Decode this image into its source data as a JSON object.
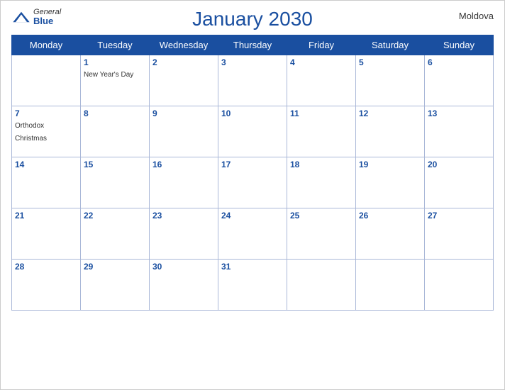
{
  "header": {
    "title": "January 2030",
    "country": "Moldova",
    "logo": {
      "general": "General",
      "blue": "Blue"
    }
  },
  "weekdays": [
    "Monday",
    "Tuesday",
    "Wednesday",
    "Thursday",
    "Friday",
    "Saturday",
    "Sunday"
  ],
  "weeks": [
    [
      {
        "day": "",
        "empty": true
      },
      {
        "day": "1",
        "event": "New Year's Day"
      },
      {
        "day": "2",
        "event": ""
      },
      {
        "day": "3",
        "event": ""
      },
      {
        "day": "4",
        "event": ""
      },
      {
        "day": "5",
        "event": ""
      },
      {
        "day": "6",
        "event": ""
      }
    ],
    [
      {
        "day": "7",
        "event": "Orthodox Christmas"
      },
      {
        "day": "8",
        "event": ""
      },
      {
        "day": "9",
        "event": ""
      },
      {
        "day": "10",
        "event": ""
      },
      {
        "day": "11",
        "event": ""
      },
      {
        "day": "12",
        "event": ""
      },
      {
        "day": "13",
        "event": ""
      }
    ],
    [
      {
        "day": "14",
        "event": ""
      },
      {
        "day": "15",
        "event": ""
      },
      {
        "day": "16",
        "event": ""
      },
      {
        "day": "17",
        "event": ""
      },
      {
        "day": "18",
        "event": ""
      },
      {
        "day": "19",
        "event": ""
      },
      {
        "day": "20",
        "event": ""
      }
    ],
    [
      {
        "day": "21",
        "event": ""
      },
      {
        "day": "22",
        "event": ""
      },
      {
        "day": "23",
        "event": ""
      },
      {
        "day": "24",
        "event": ""
      },
      {
        "day": "25",
        "event": ""
      },
      {
        "day": "26",
        "event": ""
      },
      {
        "day": "27",
        "event": ""
      }
    ],
    [
      {
        "day": "28",
        "event": ""
      },
      {
        "day": "29",
        "event": ""
      },
      {
        "day": "30",
        "event": ""
      },
      {
        "day": "31",
        "event": ""
      },
      {
        "day": "",
        "empty": true
      },
      {
        "day": "",
        "empty": true
      },
      {
        "day": "",
        "empty": true
      }
    ]
  ]
}
